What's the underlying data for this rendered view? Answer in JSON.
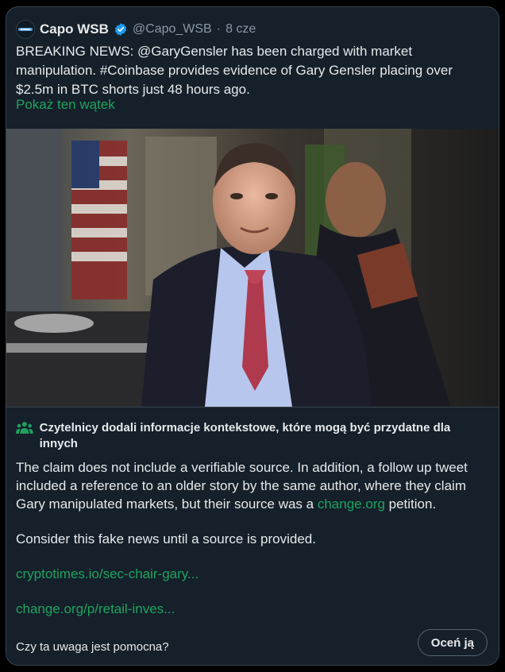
{
  "post": {
    "author_name": "Capo WSB",
    "handle": "@Capo_WSB",
    "separator": "·",
    "time": "8 cze",
    "text": "BREAKING NEWS: @GaryGensler has been charged with market manipulation. #Coinbase provides evidence of Gary Gensler placing over $2.5m in BTC shorts just 48 hours ago.",
    "thread_link": "Pokaż ten wątek",
    "avatar_icon": "capo-wsb-logo",
    "verified_icon": "verified-badge-icon"
  },
  "note": {
    "icon": "people-icon",
    "title": "Czytelnicy dodali informacje kontekstowe, które mogą być przydatne dla innych",
    "body_part1": "The claim does not include a verifiable source. In addition, a follow up tweet included a reference to an older story by the same author, where they claim Gary manipulated markets, but their source was a ",
    "body_link": "change.org",
    "body_part2": " petition.",
    "paragraph2": "Consider this fake news until a source is provided.",
    "link1": "cryptotimes.io/sec-chair-gary...",
    "link2": "change.org/p/retail-inves...",
    "helpful_question": "Czy ta uwaga jest pomocna?",
    "rate_button": "Oceń ją"
  },
  "colors": {
    "background": "#15202b",
    "accent_green": "#1fa35c",
    "text": "#e7e9ea",
    "muted": "#8b98a5",
    "border": "#38444d"
  }
}
